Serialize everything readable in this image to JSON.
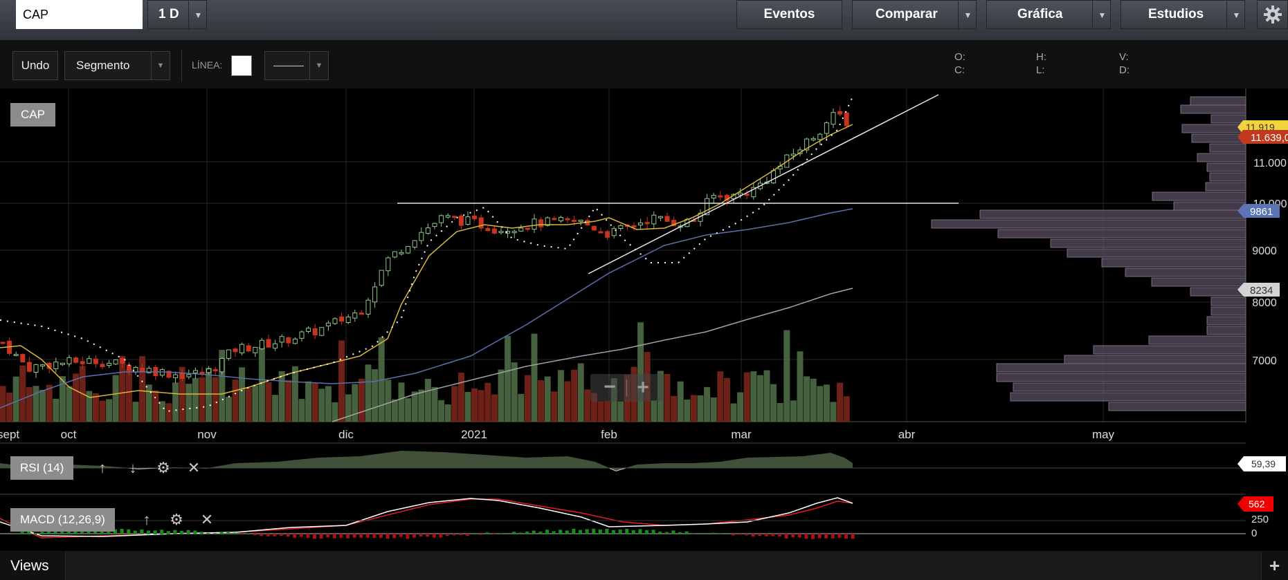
{
  "top_bar": {
    "symbol_value": "CAP",
    "interval": "1 D",
    "eventos": "Eventos",
    "comparar": "Comparar",
    "grafica": "Gráfica",
    "estudios": "Estudios"
  },
  "toolbar": {
    "undo": "Undo",
    "draw_tool": "Segmento",
    "line_label": "LÍNEA:",
    "line_color": "#ffffff"
  },
  "ohlc": {
    "o": "O:",
    "h": "H:",
    "l": "L:",
    "c": "C:",
    "v": "V:",
    "d": "D:"
  },
  "main_chart": {
    "symbol_tag": "CAP",
    "months": [
      "sept",
      "oct",
      "nov",
      "dic",
      "2021",
      "feb",
      "mar",
      "abr",
      "may"
    ],
    "y_ticks": [
      "11.000",
      "10.000",
      "9000",
      "8000",
      "7000"
    ],
    "price_tags": [
      {
        "text": "11.919",
        "color": "#f2d33b",
        "text_color": "#333333"
      },
      {
        "text": "11.639,0",
        "color": "#c0391e",
        "text_color": "#ffffff"
      },
      {
        "text": "9861",
        "color": "#5a74b5",
        "text_color": "#ffffff"
      },
      {
        "text": "8234",
        "color": "#d4d4d4",
        "text_color": "#333333"
      }
    ],
    "zoom_out": "−",
    "zoom_in": "+",
    "colors": {
      "up": "#8fc98a",
      "down": "#c8341f",
      "ema_fast": "#d9b73c",
      "sma_mid": "#5b6fae",
      "sma_slow": "#a3a3a3"
    }
  },
  "rsi": {
    "label": "RSI (14)",
    "value": "59,39"
  },
  "macd": {
    "label": "MACD (12,26,9)",
    "value": "562",
    "tick_250": "250",
    "tick_0": "0"
  },
  "footer": {
    "views": "Views",
    "add": "+"
  }
}
